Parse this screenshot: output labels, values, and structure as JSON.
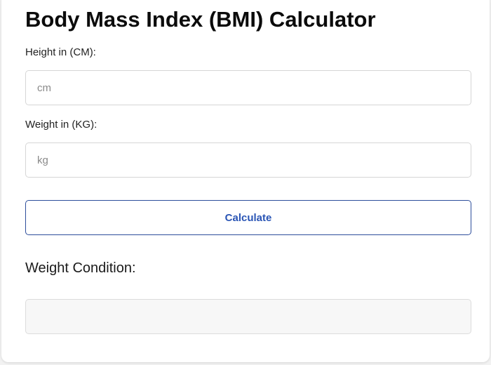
{
  "title": "Body Mass Index (BMI) Calculator",
  "height": {
    "label": "Height in (CM):",
    "value": "",
    "placeholder": "cm"
  },
  "weight": {
    "label": "Weight in (KG):",
    "value": "",
    "placeholder": "kg"
  },
  "calculate_button": {
    "label": "Calculate"
  },
  "result": {
    "label": "Weight Condition:",
    "value": ""
  },
  "colors": {
    "button_border": "#2d4e9b",
    "button_text": "#2a55b5",
    "result_background": "#f7f7f7"
  }
}
